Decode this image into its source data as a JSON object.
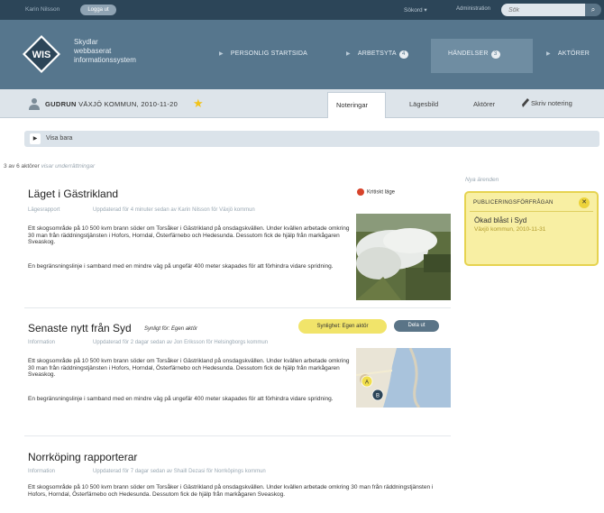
{
  "topbar": {
    "user": "Karin Nilsson",
    "logout": "Logga ut",
    "search_mode": "Sökord",
    "admin": "Administration",
    "search_placeholder": "Sök"
  },
  "header": {
    "logo": "WIS",
    "logo_text": [
      "Skydlar",
      "webbaserat",
      "informationssystem"
    ],
    "nav": [
      {
        "label": "PERSONLIG STARTSIDA",
        "badge": ""
      },
      {
        "label": "ARBETSYTA",
        "badge": "4"
      },
      {
        "label": "HÄNDELSER",
        "badge": "3"
      },
      {
        "label": "AKTÖRER",
        "badge": ""
      }
    ]
  },
  "subbar": {
    "org_bold": "GUDRUN",
    "org_rest": "VÄXJÖ KOMMUN, 2010-11-20",
    "tabs": [
      "Noteringar",
      "Lägesbild",
      "Aktörer"
    ],
    "write_note": "Skriv notering"
  },
  "filter": {
    "label": "Visa bara"
  },
  "count": {
    "main": "3 av 6 aktörer",
    "rest": "visar underrättningar"
  },
  "items": [
    {
      "title": "Läget i Gästrikland",
      "type": "Lägesrapport",
      "meta": "Uppdaterad för 4 minuter sedan av Karin Nilsson för Växjö kommun",
      "body1": "Ett skogsområde på 10 500 kvm brann söder om Torsåker i Gästrikland på onsdagskvällen. Under kvällen arbetade omkring 30 man från räddningstjänsten i Hofors, Horndal, Österfärnebo och Hedesunda. Dessutom fick de hjälp från markågaren Sveaskog.",
      "body2": "En begränsningslinje i samband med en mindre väg på ungefär 400 meter skapades för att förhindra vidare spridning.",
      "status": "Kritiskt läge"
    },
    {
      "title": "Senaste nytt från Syd",
      "type": "Information",
      "meta": "Uppdaterad för 2 dagar sedan av Jon Eriksson för Helsingborgs kommun",
      "visible_for": "Synligt för: Egen aktör",
      "visibility_btn": "Synlighet: Egen aktör",
      "share_btn": "Dela ut",
      "body1": "Ett skogsområde på 10 500 kvm brann söder om Torsåker i Gästrikland på onsdagskvällen. Under kvällen arbetade omkring 30 man från räddningstjänsten i Hofors, Horndal, Österfärnebo och Hedesunda. Dessutom fick de hjälp från markågaren Sveaskog.",
      "body2": "En begränsningslinje i samband med en mindre väg på ungefär 400 meter skapades för att förhindra vidare spridning.",
      "map_markers": [
        "A",
        "B"
      ]
    },
    {
      "title": "Norrköping rapporterar",
      "type": "Information",
      "meta": "Uppdaterad för 7 dagar sedan av Shaill Dezasi för Norrköpings kommun",
      "body1": "Ett skogsområde på 10 500 kvm brann söder om Torsåker i Gästrikland på onsdagskvällen. Under kvällen arbetade omkring 30 man från räddningstjänsten i Hofors, Horndal, Österfärnebo och Hedesunda. Dessutom fick de hjälp från markågaren Sveaskog."
    }
  ],
  "side": {
    "label": "Nya ärenden",
    "notice_head": "PUBLICERINGSFÖRFRÅGAN",
    "notice_title": "Ökad blåst i Syd",
    "notice_sub": "Växjö kommun, 2010-11-31"
  },
  "colors": {
    "topbar": "#2c4558",
    "header": "#56768d",
    "accent_yellow": "#f1e46a",
    "critical": "#d7432b"
  }
}
